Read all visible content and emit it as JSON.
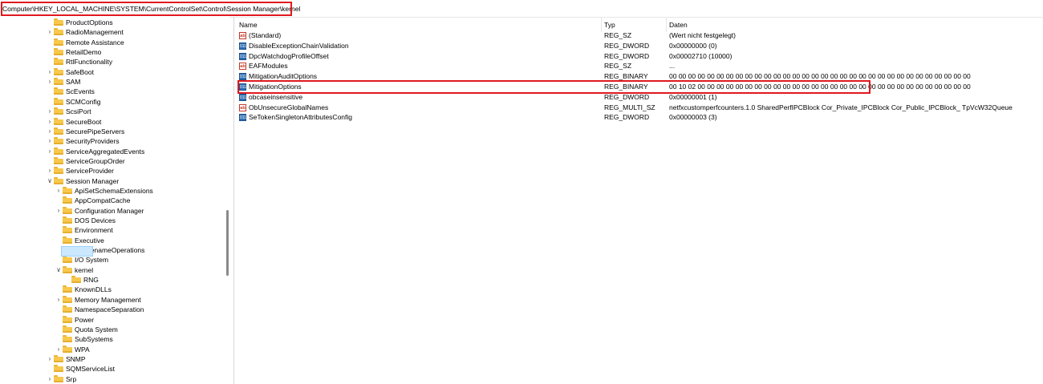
{
  "address_bar": {
    "path": "Computer\\HKEY_LOCAL_MACHINE\\SYSTEM\\CurrentControlSet\\Control\\Session Manager\\kernel"
  },
  "colors": {
    "highlight_box": "#e0191e",
    "folder": "#f7c84b",
    "selection": "#cce8ff"
  },
  "tree": {
    "nodes": [
      {
        "label": "ProductOptions",
        "level": 0,
        "chevron": ""
      },
      {
        "label": "RadioManagement",
        "level": 0,
        "chevron": ">"
      },
      {
        "label": "Remote Assistance",
        "level": 0,
        "chevron": ""
      },
      {
        "label": "RetailDemo",
        "level": 0,
        "chevron": ""
      },
      {
        "label": "RtlFunctionality",
        "level": 0,
        "chevron": ""
      },
      {
        "label": "SafeBoot",
        "level": 0,
        "chevron": ">"
      },
      {
        "label": "SAM",
        "level": 0,
        "chevron": ">"
      },
      {
        "label": "ScEvents",
        "level": 0,
        "chevron": ""
      },
      {
        "label": "SCMConfig",
        "level": 0,
        "chevron": ""
      },
      {
        "label": "ScsiPort",
        "level": 0,
        "chevron": ">"
      },
      {
        "label": "SecureBoot",
        "level": 0,
        "chevron": ">"
      },
      {
        "label": "SecurePipeServers",
        "level": 0,
        "chevron": ">"
      },
      {
        "label": "SecurityProviders",
        "level": 0,
        "chevron": ">"
      },
      {
        "label": "ServiceAggregatedEvents",
        "level": 0,
        "chevron": ">"
      },
      {
        "label": "ServiceGroupOrder",
        "level": 0,
        "chevron": ""
      },
      {
        "label": "ServiceProvider",
        "level": 0,
        "chevron": ">"
      },
      {
        "label": "Session Manager",
        "level": 0,
        "chevron": "v"
      },
      {
        "label": "ApiSetSchemaExtensions",
        "level": 1,
        "chevron": ">"
      },
      {
        "label": "AppCompatCache",
        "level": 1,
        "chevron": ""
      },
      {
        "label": "Configuration Manager",
        "level": 1,
        "chevron": ">"
      },
      {
        "label": "DOS Devices",
        "level": 1,
        "chevron": ""
      },
      {
        "label": "Environment",
        "level": 1,
        "chevron": ""
      },
      {
        "label": "Executive",
        "level": 1,
        "chevron": ""
      },
      {
        "label": "FileRenameOperations",
        "level": 1,
        "chevron": ""
      },
      {
        "label": "I/O System",
        "level": 1,
        "chevron": ""
      },
      {
        "label": "kernel",
        "level": 1,
        "chevron": "v",
        "selected": true
      },
      {
        "label": "RNG",
        "level": 2,
        "chevron": ""
      },
      {
        "label": "KnownDLLs",
        "level": 1,
        "chevron": ""
      },
      {
        "label": "Memory Management",
        "level": 1,
        "chevron": ">"
      },
      {
        "label": "NamespaceSeparation",
        "level": 1,
        "chevron": ""
      },
      {
        "label": "Power",
        "level": 1,
        "chevron": ""
      },
      {
        "label": "Quota System",
        "level": 1,
        "chevron": ""
      },
      {
        "label": "SubSystems",
        "level": 1,
        "chevron": ""
      },
      {
        "label": "WPA",
        "level": 1,
        "chevron": ">"
      },
      {
        "label": "SNMP",
        "level": 0,
        "chevron": ">"
      },
      {
        "label": "SQMServiceList",
        "level": 0,
        "chevron": ""
      },
      {
        "label": "Srp",
        "level": 0,
        "chevron": ">"
      }
    ]
  },
  "list": {
    "headers": {
      "name": "Name",
      "type": "Typ",
      "data": "Daten"
    },
    "rows": [
      {
        "icon": "string-value-icon",
        "name": "(Standard)",
        "type": "REG_SZ",
        "data": "(Wert nicht festgelegt)"
      },
      {
        "icon": "binary-value-icon",
        "name": "DisableExceptionChainValidation",
        "type": "REG_DWORD",
        "data": "0x00000000 (0)"
      },
      {
        "icon": "binary-value-icon",
        "name": "DpcWatchdogProfileOffset",
        "type": "REG_DWORD",
        "data": "0x00002710 (10000)"
      },
      {
        "icon": "string-value-icon",
        "name": "EAFModules",
        "type": "REG_SZ",
        "data": "..."
      },
      {
        "icon": "binary-value-icon",
        "name": "MitigationAuditOptions",
        "type": "REG_BINARY",
        "data": "00 00 00 00 00 00 00 00 00 00 00 00 00 00 00 00 00 00 00 00 00 00 00 00 00 00 00 00 00 00 00 00"
      },
      {
        "icon": "binary-value-icon",
        "name": "MitigationOptions",
        "type": "REG_BINARY",
        "data": "00 10 02 00 00 00 00 00 00 00 00 00 00 00 00 00 00 00 00 00 00 00 00 00 00 00 00 00 00 00 00 00",
        "highlighted": true
      },
      {
        "icon": "binary-value-icon",
        "name": "obcaseinsensitive",
        "type": "REG_DWORD",
        "data": "0x00000001 (1)"
      },
      {
        "icon": "string-value-icon",
        "name": "ObUnsecureGlobalNames",
        "type": "REG_MULTI_SZ",
        "data": "netfxcustomperfcounters.1.0 SharedPerfIPCBlock Cor_Private_IPCBlock Cor_Public_IPCBlock_ TpVcW32Queue"
      },
      {
        "icon": "binary-value-icon",
        "name": "SeTokenSingletonAttributesConfig",
        "type": "REG_DWORD",
        "data": "0x00000003 (3)"
      }
    ]
  }
}
